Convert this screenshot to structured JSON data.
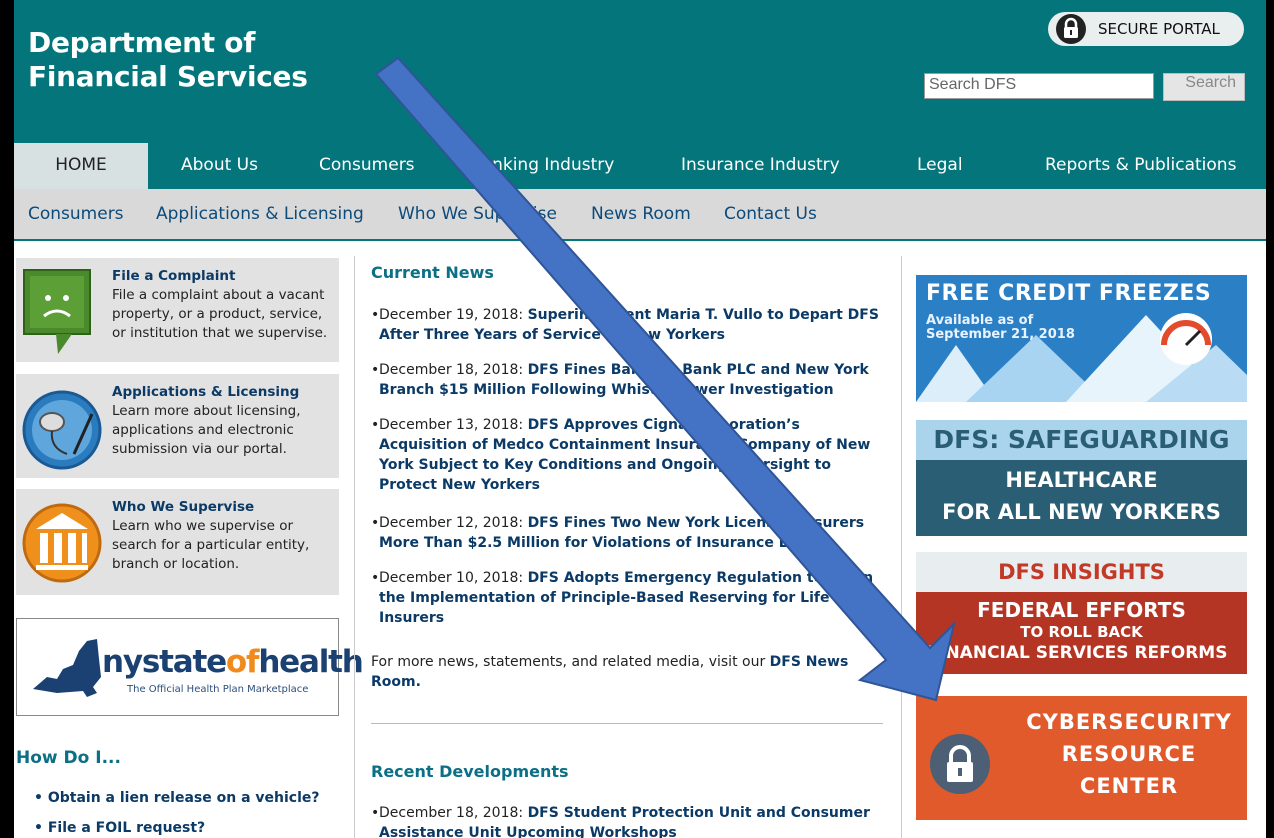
{
  "header": {
    "title_line1": "Department of",
    "title_line2": "Financial Services",
    "secure_portal": "SECURE PORTAL",
    "search_placeholder": "Search DFS",
    "search_button": "Search"
  },
  "main_nav": [
    "HOME",
    "About Us",
    "Consumers",
    "Banking Industry",
    "Insurance Industry",
    "Legal",
    "Reports & Publications"
  ],
  "sub_nav": [
    "Consumers",
    "Applications & Licensing",
    "Who We Supervise",
    "News Room",
    "Contact Us"
  ],
  "cards": [
    {
      "title": "File a Complaint",
      "desc": "File a complaint about a vacant property, or a product, service, or institution that we supervise."
    },
    {
      "title": "Applications & Licensing",
      "desc": "Learn more about licensing, applications and electronic submission via our portal."
    },
    {
      "title": "Who We Supervise",
      "desc": "Learn who we supervise or search for a particular entity, branch or location."
    }
  ],
  "nyhealth": {
    "word_a": "nystate",
    "word_b": "of",
    "word_c": "health",
    "sub": "The Official Health Plan Marketplace"
  },
  "how_do_i": {
    "title": "How Do I...",
    "items": [
      "Obtain a lien release on a vehicle?",
      "File a FOIL request?"
    ]
  },
  "current_news": {
    "title": "Current News",
    "items": [
      {
        "date": "December 19, 2018: ",
        "text": "Superintendent Maria T. Vullo to Depart DFS After Three Years of Service to New Yorkers"
      },
      {
        "date": "December 18, 2018: ",
        "text": "DFS Fines Barclays Bank PLC and New York Branch $15 Million Following Whistleblower Investigation"
      },
      {
        "date": "December 13, 2018: ",
        "text": "DFS Approves Cigna Corporation’s Acquisition of Medco Containment Insurance Company of New York Subject to Key Conditions and Ongoing Oversight to Protect New Yorkers"
      },
      {
        "date": "December 12, 2018: ",
        "text": "DFS Fines Two New York Licensed Insurers More Than $2.5 Million for Violations of Insurance Law"
      },
      {
        "date": "December 10, 2018: ",
        "text": "DFS Adopts Emergency Regulation to Begin the Implementation of Principle-Based Reserving for Life Insurers"
      }
    ],
    "more_pre": "For more news, statements, and related media, visit our ",
    "more_link": "DFS News Room."
  },
  "recent": {
    "title": "Recent Developments",
    "items": [
      {
        "date": "December 18, 2018: ",
        "text": "DFS Student Protection Unit and Consumer Assistance Unit Upcoming Workshops"
      }
    ]
  },
  "banners": {
    "credit": {
      "title": "FREE CREDIT FREEZES",
      "sub1": "Available as of",
      "sub2": "September 21, 2018"
    },
    "health": {
      "line1": "DFS: SAFEGUARDING",
      "line2": "HEALTHCARE",
      "line3": "FOR ALL NEW YORKERS"
    },
    "insights": {
      "line1": "DFS INSIGHTS",
      "line2": "FEDERAL EFFORTS",
      "line3": "TO ROLL BACK",
      "line4": "FINANCIAL SERVICES REFORMS"
    },
    "cyber": {
      "line1": "CYBERSECURITY",
      "line2": "RESOURCE",
      "line3": "CENTER"
    }
  },
  "colors": {
    "teal": "#04757a",
    "navy": "#0b3a66",
    "orange": "#e15a2b",
    "arrow": "#4472c4"
  }
}
